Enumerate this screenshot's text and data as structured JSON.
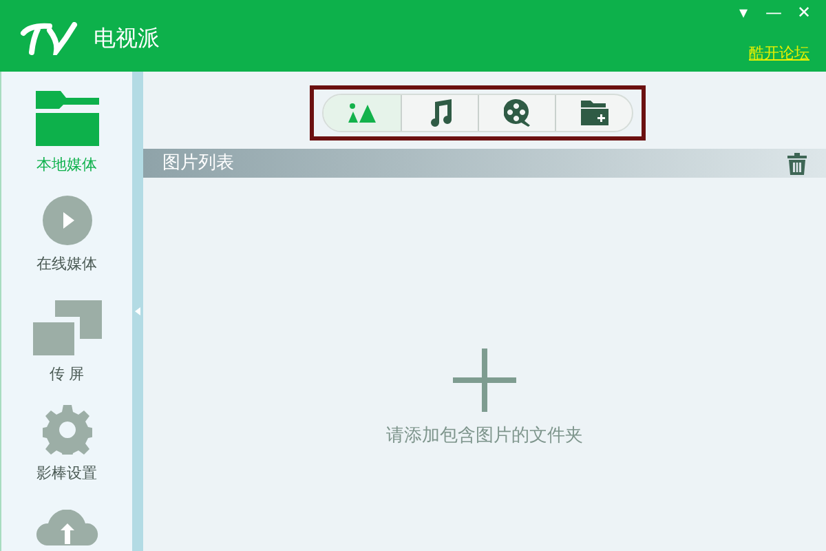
{
  "window": {
    "title": "电视派",
    "controls": [
      "▾",
      "—",
      "✕"
    ],
    "link": "酷开论坛"
  },
  "sidebar": {
    "items": [
      {
        "kind": "folder",
        "label": "本地媒体",
        "selected": true
      },
      {
        "kind": "play",
        "label": "在线媒体",
        "selected": false
      },
      {
        "kind": "screens",
        "label": "传 屏",
        "selected": false
      },
      {
        "kind": "gear",
        "label": "影棒设置",
        "selected": false
      },
      {
        "kind": "cloud",
        "selected": false
      }
    ]
  },
  "toolbar": {
    "tabs": [
      {
        "kind": "pictures",
        "selected": true
      },
      {
        "kind": "music",
        "selected": false
      },
      {
        "kind": "video",
        "selected": false
      },
      {
        "kind": "add-folder",
        "selected": false
      }
    ]
  },
  "list": {
    "title": "图片列表",
    "empty_message": "请添加包含图片的文件夹"
  }
}
